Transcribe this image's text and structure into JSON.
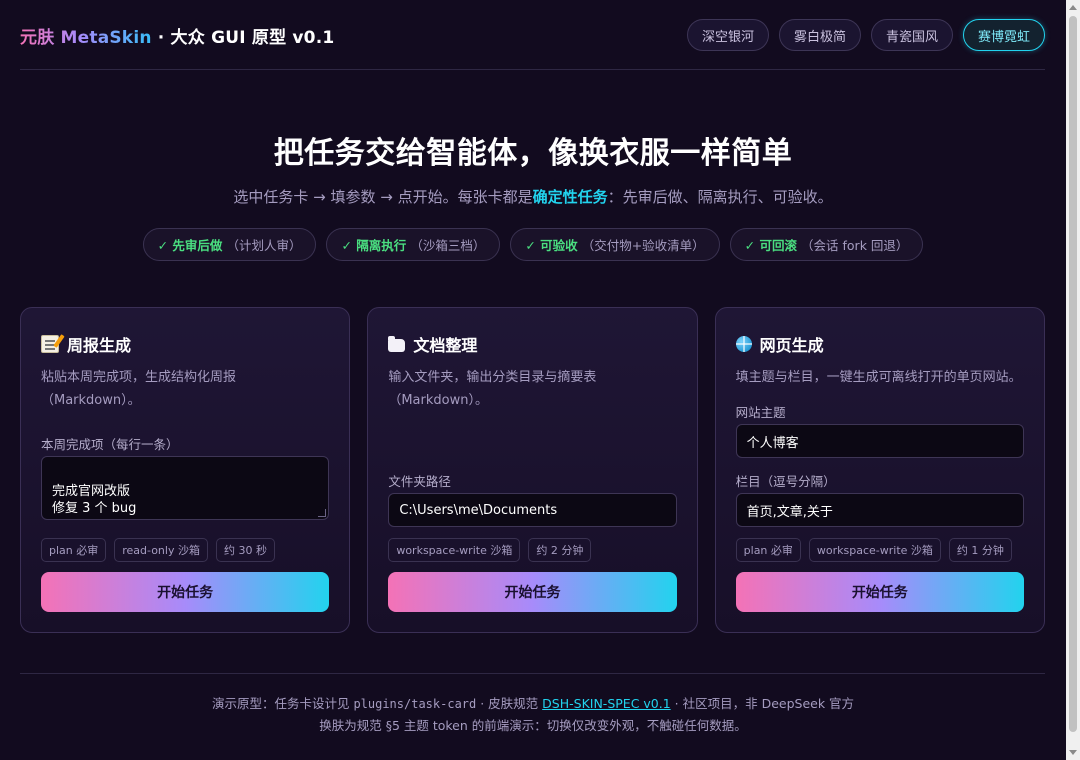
{
  "header": {
    "brand_gradient": "元肤 MetaSkin",
    "brand_rest": " · 大众 GUI 原型 v0.1",
    "skins": [
      {
        "label": "深空银河",
        "active": false
      },
      {
        "label": "雾白极简",
        "active": false
      },
      {
        "label": "青瓷国风",
        "active": false
      },
      {
        "label": "赛博霓虹",
        "active": true
      }
    ]
  },
  "hero": {
    "title": "把任务交给智能体，像换衣服一样简单",
    "subtitle_before": "选中任务卡 → 填参数 → 点开始。每张卡都是",
    "subtitle_highlight": "确定性任务",
    "subtitle_after": "：先审后做、隔离执行、可验收。",
    "pills": [
      {
        "check": "✓",
        "label": "先审后做",
        "note": "（计划人审）"
      },
      {
        "check": "✓",
        "label": "隔离执行",
        "note": "（沙箱三档）"
      },
      {
        "check": "✓",
        "label": "可验收",
        "note": "（交付物+验收清单）"
      },
      {
        "check": "✓",
        "label": "可回滚",
        "note": "（会话 fork 回退）"
      }
    ]
  },
  "cards": [
    {
      "icon": "memo-icon",
      "title": "周报生成",
      "desc": "粘贴本周完成项，生成结构化周报（Markdown）。",
      "field_label": "本周完成项（每行一条）",
      "field_value": "完成官网改版\n修复 3 个 bug",
      "tags": [
        "plan 必审",
        "read-only 沙箱",
        "约 30 秒"
      ],
      "button": "开始任务"
    },
    {
      "icon": "folder-icon",
      "title": "文档整理",
      "desc": "输入文件夹，输出分类目录与摘要表（Markdown）。",
      "field_label": "文件夹路径",
      "field_value": "C:\\Users\\me\\Documents",
      "tags": [
        "workspace-write 沙箱",
        "约 2 分钟"
      ],
      "button": "开始任务"
    },
    {
      "icon": "globe-icon",
      "title": "网页生成",
      "desc": "填主题与栏目，一键生成可离线打开的单页网站。",
      "field1_label": "网站主题",
      "field1_value": "个人博客",
      "field2_label": "栏目（逗号分隔）",
      "field2_value": "首页,文章,关于",
      "tags": [
        "plan 必审",
        "workspace-write 沙箱",
        "约 1 分钟"
      ],
      "button": "开始任务"
    }
  ],
  "footer": {
    "line1_a": "演示原型：任务卡设计见 ",
    "line1_code": "plugins/task-card",
    "line1_b": " · 皮肤规范 ",
    "line1_link": "DSH-SKIN-SPEC v0.1",
    "line1_c": " · 社区项目，非 DeepSeek 官方",
    "line2": "换肤为规范 §5 主题 token 的前端演示：切换仅改变外观，不触碰任何数据。"
  },
  "colors": {
    "background": "#120b1f",
    "accent_cyan": "#22d3ee",
    "accent_pink": "#f472b6",
    "accent_violet": "#a78bfa",
    "ok_green": "#4ade80"
  }
}
